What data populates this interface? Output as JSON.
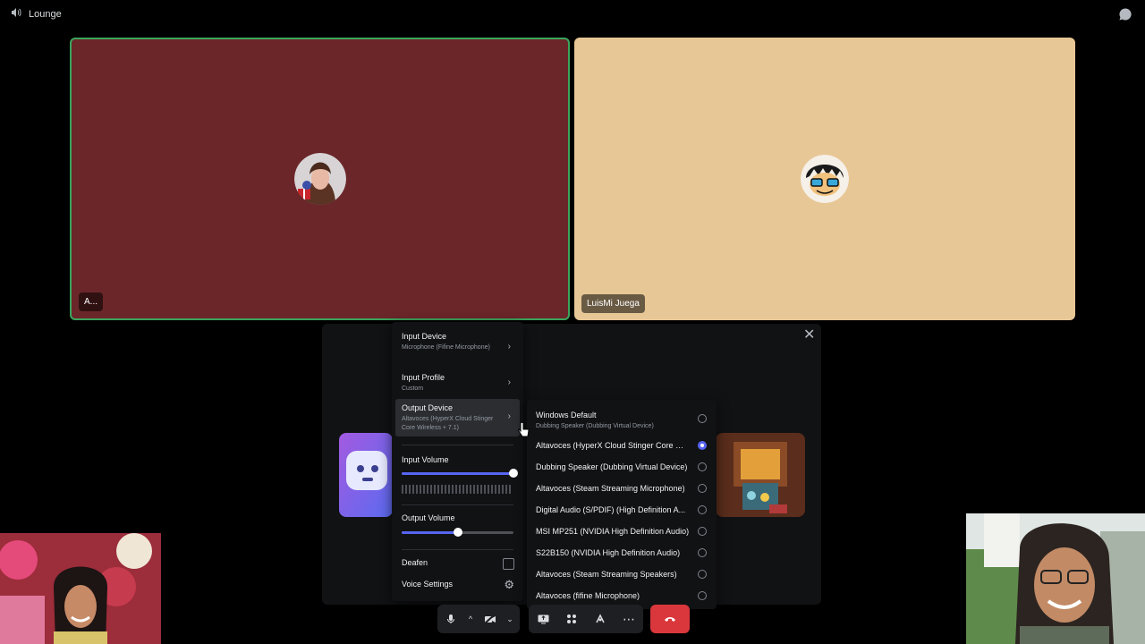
{
  "channel": {
    "name": "Lounge",
    "icon": "speaker-icon"
  },
  "participants": [
    {
      "name": "A...",
      "tile_color": "#6b2629",
      "speaking": true
    },
    {
      "name": "LuisMi Juega",
      "tile_color": "#e8c796",
      "speaking": false
    }
  ],
  "voice_menu": {
    "input_device": {
      "label": "Input Device",
      "value": "Microphone (Fifine Microphone)"
    },
    "input_profile": {
      "label": "Input Profile",
      "value": "Custom"
    },
    "output_device": {
      "label": "Output Device",
      "value": "Altavoces (HyperX Cloud Stinger Core Wireless + 7.1)"
    },
    "input_volume": {
      "label": "Input Volume",
      "value": 1.0
    },
    "output_volume": {
      "label": "Output Volume",
      "value": 0.5
    },
    "deafen": {
      "label": "Deafen",
      "checked": false
    },
    "voice_settings": {
      "label": "Voice Settings"
    }
  },
  "output_devices": {
    "default": {
      "label": "Windows Default",
      "sub": "Dubbing Speaker (Dubbing Virtual Device)"
    },
    "options": [
      {
        "label": "Altavoces (HyperX Cloud Stinger Core Wi...",
        "selected": true
      },
      {
        "label": "Dubbing Speaker (Dubbing Virtual Device)",
        "selected": false
      },
      {
        "label": "Altavoces (Steam Streaming Microphone)",
        "selected": false
      },
      {
        "label": "Digital Audio (S/PDIF) (High Definition A...",
        "selected": false
      },
      {
        "label": "MSI MP251 (NVIDIA High Definition Audio)",
        "selected": false
      },
      {
        "label": "S22B150 (NVIDIA High Definition Audio)",
        "selected": false
      },
      {
        "label": "Altavoces (Steam Streaming Speakers)",
        "selected": false
      },
      {
        "label": "Altavoces (fifine Microphone)",
        "selected": false
      }
    ]
  },
  "colors": {
    "accent": "#5865f2",
    "speaking": "#3ba55c",
    "danger": "#da373c"
  }
}
